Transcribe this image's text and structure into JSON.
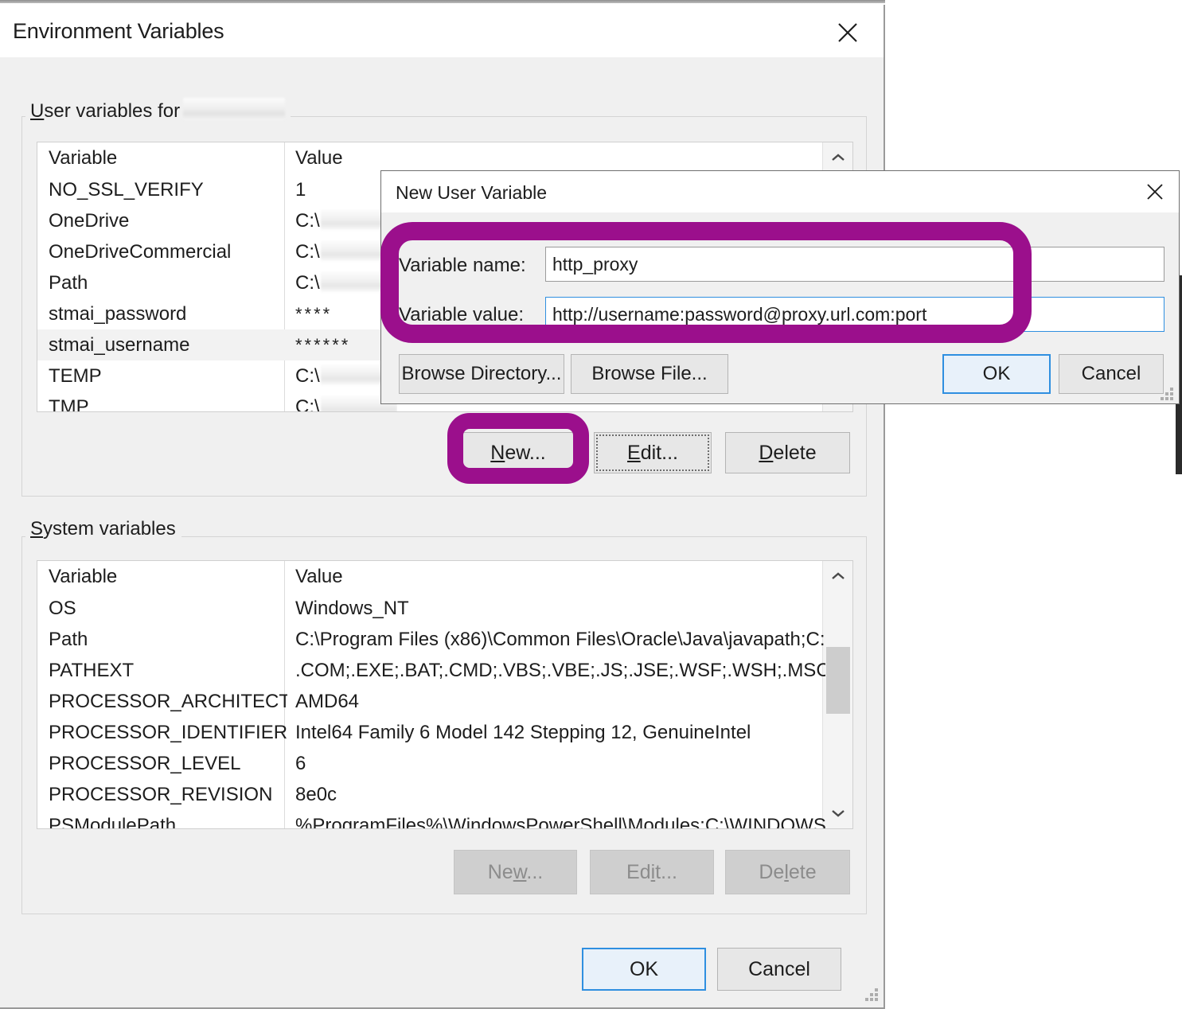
{
  "colors": {
    "annotation_purple": "#9B0F8C",
    "accent_blue": "#2F8FE0",
    "window_bg": "#F0F0F0",
    "list_bg": "#FFFFFF"
  },
  "main_window": {
    "title": "Environment Variables",
    "close_icon": "close-icon",
    "user_group": {
      "legend_prefix": "User variables for",
      "legend_accel": "U",
      "legend_redacted_username": ""
    },
    "system_group": {
      "legend": "System variables",
      "legend_accel": "S"
    },
    "columns": {
      "variable": "Variable",
      "value": "Value"
    },
    "user_variables": [
      {
        "name": "NO_SSL_VERIFY",
        "value": "1",
        "redacted": false,
        "selected": false
      },
      {
        "name": "OneDrive",
        "value": "C:\\",
        "redacted": true,
        "selected": false
      },
      {
        "name": "OneDriveCommercial",
        "value": "C:\\",
        "redacted": true,
        "selected": false
      },
      {
        "name": "Path",
        "value": "C:\\",
        "redacted": true,
        "selected": false
      },
      {
        "name": "stmai_password",
        "value": "****",
        "redacted": false,
        "selected": false
      },
      {
        "name": "stmai_username",
        "value": "******",
        "redacted": false,
        "selected": true
      },
      {
        "name": "TEMP",
        "value": "C:\\",
        "redacted": true,
        "selected": false
      },
      {
        "name": "TMP",
        "value": "C:\\",
        "redacted": true,
        "selected": false
      }
    ],
    "system_variables": [
      {
        "name": "OS",
        "value": "Windows_NT"
      },
      {
        "name": "Path",
        "value": "C:\\Program Files (x86)\\Common Files\\Oracle\\Java\\javapath;C:..."
      },
      {
        "name": "PATHEXT",
        "value": ".COM;.EXE;.BAT;.CMD;.VBS;.VBE;.JS;.JSE;.WSF;.WSH;.MSC"
      },
      {
        "name": "PROCESSOR_ARCHITECTU...",
        "value": "AMD64"
      },
      {
        "name": "PROCESSOR_IDENTIFIER",
        "value": "Intel64 Family 6 Model 142 Stepping 12, GenuineIntel"
      },
      {
        "name": "PROCESSOR_LEVEL",
        "value": "6"
      },
      {
        "name": "PROCESSOR_REVISION",
        "value": "8e0c"
      },
      {
        "name": "PSModulePath",
        "value": "%ProgramFiles%\\WindowsPowerShell\\Modules;C:\\WINDOWS"
      }
    ],
    "user_buttons": {
      "new": {
        "label": "New...",
        "accel": "N",
        "enabled": true,
        "highlighted": true
      },
      "edit": {
        "label": "Edit...",
        "accel": "E",
        "enabled": true,
        "focused": true
      },
      "delete": {
        "label": "Delete",
        "accel": "D",
        "enabled": true
      }
    },
    "system_buttons": {
      "new": {
        "label": "New...",
        "accel": "w",
        "enabled": false
      },
      "edit": {
        "label": "Edit...",
        "accel": "i",
        "enabled": false
      },
      "delete": {
        "label": "Delete",
        "accel": "l",
        "enabled": false
      }
    },
    "footer_buttons": {
      "ok": {
        "label": "OK",
        "is_default": true
      },
      "cancel": {
        "label": "Cancel"
      }
    },
    "scrollbars": {
      "up_arrow_icon": "chevron-up-icon",
      "down_arrow_icon": "chevron-down-icon"
    }
  },
  "new_user_variable_dialog": {
    "title": "New User Variable",
    "close_icon": "close-icon",
    "variable_name": {
      "label": "Variable name:",
      "value": "http_proxy",
      "focused": false
    },
    "variable_value": {
      "label": "Variable value:",
      "value": "http://username:password@proxy.url.com:port",
      "focused": true
    },
    "buttons": {
      "browse_directory": "Browse Directory...",
      "browse_file": "Browse File...",
      "ok": "OK",
      "cancel": "Cancel"
    },
    "resize_grip_icon": "resize-grip-icon"
  },
  "annotations": [
    {
      "name": "fields-highlight",
      "shape": "rounded-rectangle",
      "color": "#9B0F8C"
    },
    {
      "name": "new-button-highlight",
      "shape": "rounded-rectangle",
      "color": "#9B0F8C"
    }
  ]
}
